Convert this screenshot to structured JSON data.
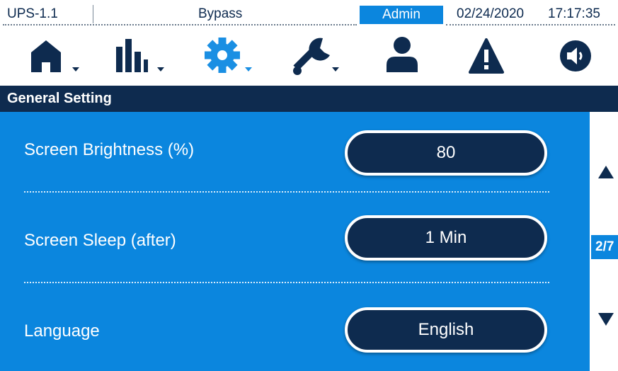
{
  "status": {
    "device": "UPS-1.1",
    "mode": "Bypass",
    "user": "Admin",
    "date": "02/24/2020",
    "time": "17:17:35"
  },
  "nav": [
    {
      "icon": "home-icon"
    },
    {
      "icon": "chart-icon"
    },
    {
      "icon": "gear-icon",
      "active": true
    },
    {
      "icon": "wrench-icon"
    },
    {
      "icon": "user-icon"
    },
    {
      "icon": "warning-icon"
    },
    {
      "icon": "speaker-icon"
    }
  ],
  "section": {
    "title": "General Setting"
  },
  "settings": [
    {
      "label": "Screen Brightness (%)",
      "value": "80"
    },
    {
      "label": "Screen Sleep (after)",
      "value": "1 Min"
    },
    {
      "label": "Language",
      "value": "English"
    }
  ],
  "pager": {
    "page": "2/7"
  },
  "colors": {
    "navy": "#0e2b4f",
    "accent_blue": "#0b86de",
    "active_icon": "#1a8fe3"
  }
}
